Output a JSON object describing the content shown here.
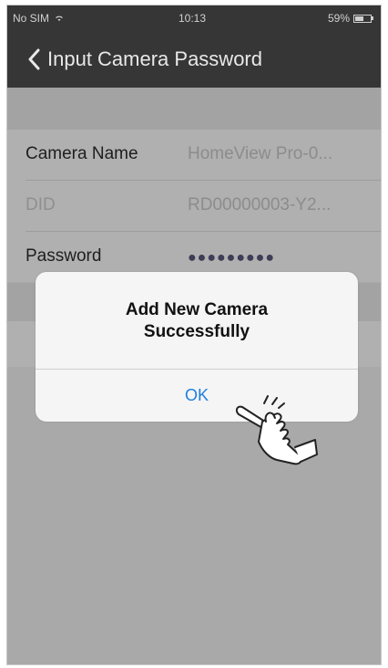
{
  "status_bar": {
    "carrier": "No SIM",
    "wifi_icon": "wifi-icon",
    "time": "10:13",
    "battery": "59%",
    "battery_level": 0.59
  },
  "header": {
    "back_icon": "chevron-left-icon",
    "title": "Input Camera Password"
  },
  "form": {
    "rows": [
      {
        "label": "Camera Name",
        "value": "HomeView Pro-0..."
      },
      {
        "label": "DID",
        "value": "RD00000003-Y2..."
      },
      {
        "label": "Password",
        "value": "●●●●●●●●●"
      }
    ]
  },
  "alert": {
    "title_line1": "Add New Camera",
    "title_line2": "Successfully",
    "ok_label": "OK"
  },
  "colors": {
    "header_bg": "#363636",
    "overlay_bg": "#a9a9a9",
    "alert_bg": "#f5f5f5",
    "ok_text": "#1f7ee0"
  },
  "icons": {
    "hand": "pointing-hand-icon"
  }
}
